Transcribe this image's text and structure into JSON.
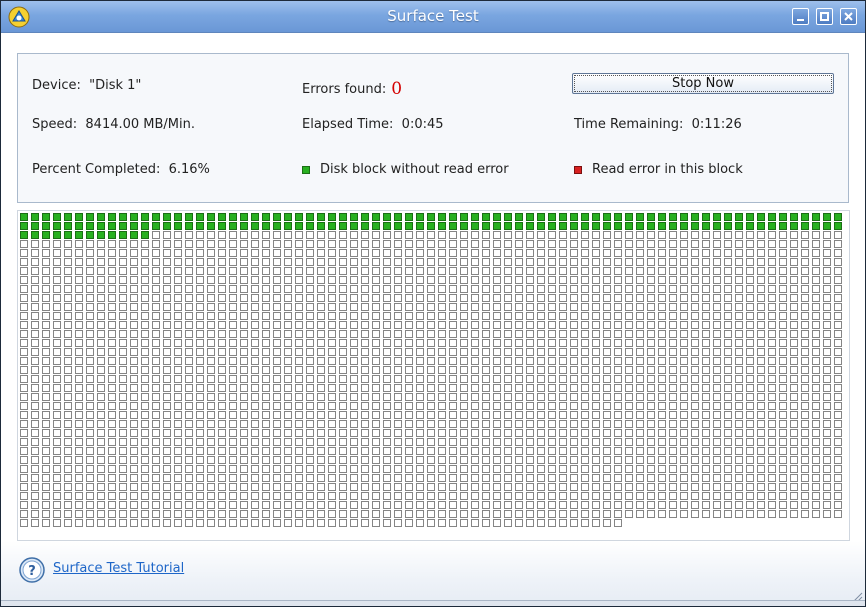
{
  "window": {
    "title": "Surface Test"
  },
  "info": {
    "device_label": "Device:",
    "device_value": "\"Disk 1\"",
    "errors_label": "Errors found:",
    "errors_value": "0",
    "stop_button": "Stop Now",
    "speed_label": "Speed:",
    "speed_value": "8414.00 MB/Min.",
    "elapsed_label": "Elapsed Time:",
    "elapsed_value": "0:0:45",
    "remaining_label": "Time Remaining:",
    "remaining_value": "0:11:26",
    "percent_label": "Percent Completed:",
    "percent_value": "6.16%",
    "legend_ok": "Disk block without read error",
    "legend_bad": "Read error in this block"
  },
  "block_map": {
    "columns": 75,
    "full_rows": 34,
    "last_row_blocks": 55,
    "blocks_scanned_ok": 162,
    "blocks_with_error": 0,
    "ok_color": "#28b020",
    "error_color": "#d82020",
    "empty_color": "#ffffff"
  },
  "footer": {
    "tutorial_link": "Surface Test Tutorial",
    "help_icon": "help-question-icon"
  }
}
